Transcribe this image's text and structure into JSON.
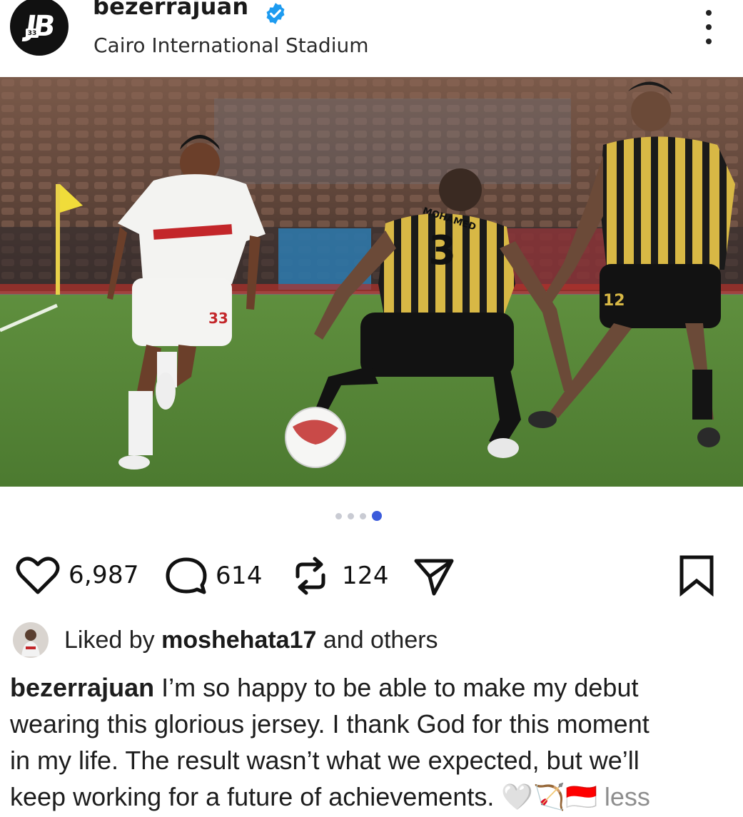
{
  "post": {
    "username": "bezerrajuan",
    "verified": true,
    "location": "Cairo International Stadium",
    "avatar_text": "JB",
    "avatar_subtext": "33"
  },
  "photo": {
    "description_icon": "football-photo",
    "jersey_text": "MOHAMED",
    "jersey_number": "3",
    "white_shirt_number": "33",
    "right_player_number": "12"
  },
  "carousel": {
    "count": 4,
    "active_index": 3
  },
  "actions": {
    "like_icon": "heart-icon",
    "like_count": "6,987",
    "comment_icon": "comment-icon",
    "comment_count": "614",
    "repost_icon": "repost-icon",
    "repost_count": "124",
    "share_icon": "send-icon",
    "save_icon": "bookmark-icon"
  },
  "likes": {
    "prefix": "Liked by",
    "user": "moshehata17",
    "suffix": "and others"
  },
  "caption": {
    "username": "bezerrajuan",
    "text_line1": "I’m so happy to be able to make my debut",
    "text_line2": "wearing this glorious jersey. I thank God for this moment",
    "text_line3": "in my life. The result wasn’t what we expected, but we’ll",
    "text_line4": "keep working for a future of achievements.",
    "emojis": "🤍🏹🇮🇩",
    "less_label": "less"
  },
  "colors": {
    "accent_blue": "#3b5bdb",
    "verified_blue": "#1d9bf0",
    "text_dark": "#1c1c1c",
    "muted": "#8e8e8e"
  }
}
